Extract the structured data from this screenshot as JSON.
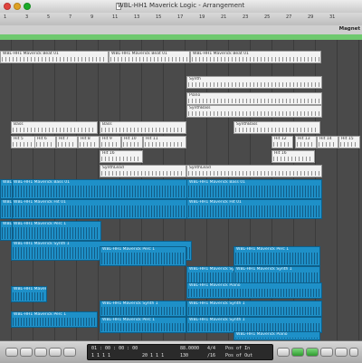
{
  "window": {
    "title": "WBL-HH1 Maverick Logic - Arrangement"
  },
  "marker": {
    "label": "Magnet"
  },
  "ruler": {
    "bars": [
      "1",
      "3",
      "5",
      "7",
      "9",
      "11",
      "13",
      "15",
      "17",
      "19",
      "21",
      "23",
      "25",
      "27",
      "29",
      "31"
    ]
  },
  "regions": [
    {
      "label": "WBL-HH1 Maverick Beat 01",
      "color": "white"
    },
    {
      "label": "Synth",
      "color": "white"
    },
    {
      "label": "Piano",
      "color": "white"
    },
    {
      "label": "Bass",
      "color": "white"
    },
    {
      "label": "SynthBass",
      "color": "white"
    },
    {
      "label": "Hit 5",
      "color": "white"
    },
    {
      "label": "Hit 6",
      "color": "white"
    },
    {
      "label": "Hit 7",
      "color": "white"
    },
    {
      "label": "Hit 8",
      "color": "white"
    },
    {
      "label": "Hit 9",
      "color": "white"
    },
    {
      "label": "Hit 10",
      "color": "white"
    },
    {
      "label": "Hit 11",
      "color": "white"
    },
    {
      "label": "Hit 12",
      "color": "white"
    },
    {
      "label": "Hit 13",
      "color": "white"
    },
    {
      "label": "Hit 14",
      "color": "white"
    },
    {
      "label": "Hit 15",
      "color": "white"
    },
    {
      "label": "Hit 16",
      "color": "white"
    },
    {
      "label": "SynthLead",
      "color": "white"
    },
    {
      "label": "WBL-HH1 Maverick Bass 01",
      "color": "blue"
    },
    {
      "label": "WBL-HH1 Maverick Hit 01",
      "color": "blue"
    },
    {
      "label": "WBL-HH1 Maverick Perc 1",
      "color": "blue"
    },
    {
      "label": "WBL-HH1 Maverick Synth 1",
      "color": "blue"
    },
    {
      "label": "WBL-HH1 Maverick Piano",
      "color": "blue"
    }
  ],
  "transport": {
    "position_smpte": "01 : 00 : 00 : 00",
    "position_bars": "1   1   1   1",
    "tempo": "88.0000",
    "signature": "4/4",
    "division": "/16",
    "subposition": "20   1   1   1",
    "barcount": "130",
    "in_label": "Pos of In",
    "out_label": "Pos of Out"
  }
}
